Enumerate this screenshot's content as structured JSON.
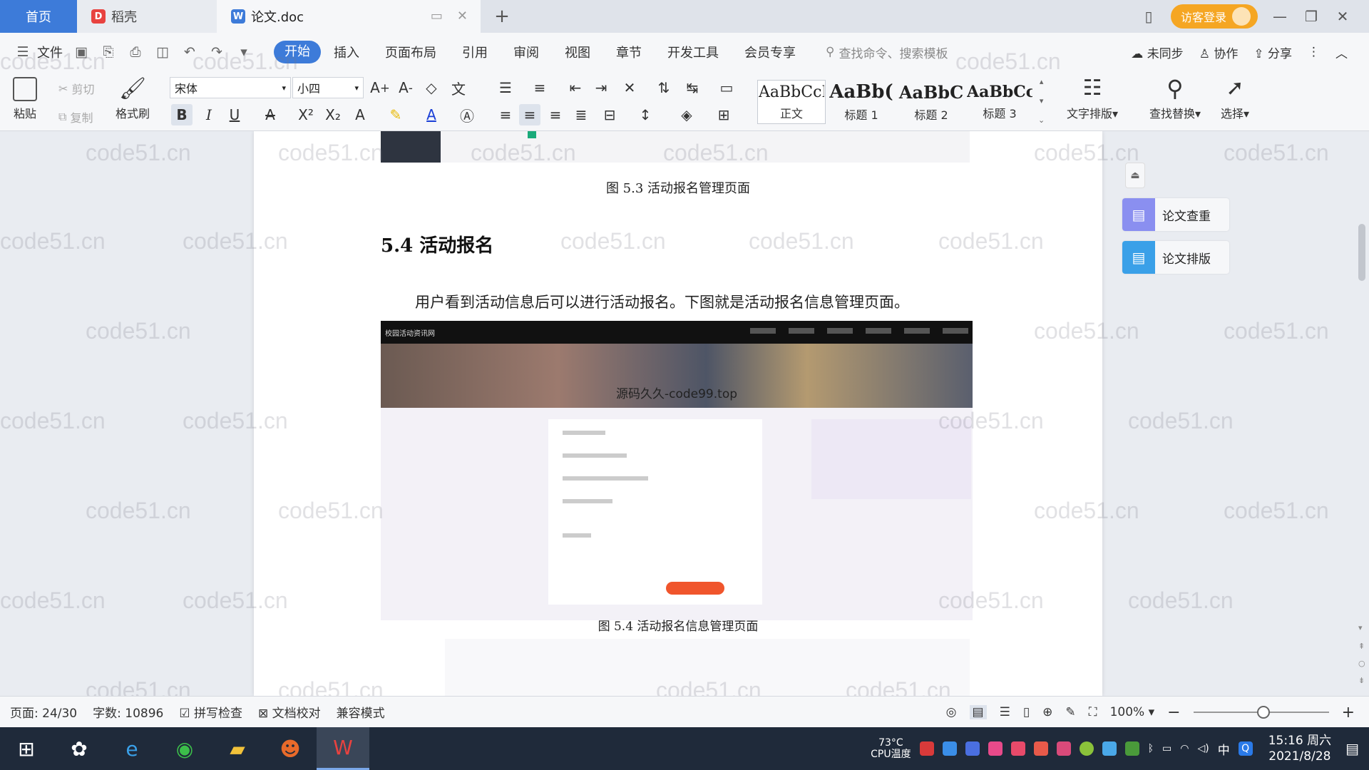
{
  "tabs": {
    "home": "首页",
    "daoke": "稻壳",
    "doc": "论文.doc",
    "new_tab_symbol": "+",
    "login": "访客登录"
  },
  "menu": {
    "file": "文件",
    "items": [
      "开始",
      "插入",
      "页面布局",
      "引用",
      "审阅",
      "视图",
      "章节",
      "开发工具",
      "会员专享"
    ],
    "active": "开始",
    "search_placeholder": "查找命令、搜索模板",
    "sync": "未同步",
    "collab": "协作",
    "share": "分享"
  },
  "ribbon": {
    "paste": "粘贴",
    "cut": "剪切",
    "copy": "复制",
    "format_painter": "格式刷",
    "font_name": "宋体",
    "font_size": "小四",
    "styles": [
      {
        "sample": "AaBbCcI",
        "name": "正文"
      },
      {
        "sample": "AaBb(",
        "name": "标题 1"
      },
      {
        "sample": "AaBbC",
        "name": "标题 2"
      },
      {
        "sample": "AaBbCcl",
        "name": "标题 3"
      }
    ],
    "text_layout": "文字排版",
    "find_replace": "查找替换",
    "select": "选择"
  },
  "document": {
    "caption_top": "图 5.3  活动报名管理页面",
    "heading": "5.4  活动报名",
    "paragraph": "用户看到活动信息后可以进行活动报名。下图就是活动报名信息管理页面。",
    "screenshot_site_title": "校园活动资讯网",
    "screenshot_banner_text": "源码久久-code99.top",
    "caption_bottom": "图 5.4  活动报名信息管理页面",
    "watermark": "code51.cn"
  },
  "sidepanel": {
    "check": "论文查重",
    "layout": "论文排版"
  },
  "status": {
    "page": "页面: 24/30",
    "words": "字数: 10896",
    "spell": "拼写检查",
    "proof": "文档校对",
    "compat": "兼容模式",
    "zoom": "100%",
    "zoom_level": 0.52
  },
  "taskbar": {
    "temp": "73°C",
    "temp_label": "CPU温度",
    "ime": "中",
    "time": "15:16 周六",
    "date": "2021/8/28"
  },
  "colors": {
    "accent": "#3d7bd9",
    "login": "#f5a623",
    "check_icon": "#8a8ff0",
    "layout_icon": "#3aa0e8"
  }
}
